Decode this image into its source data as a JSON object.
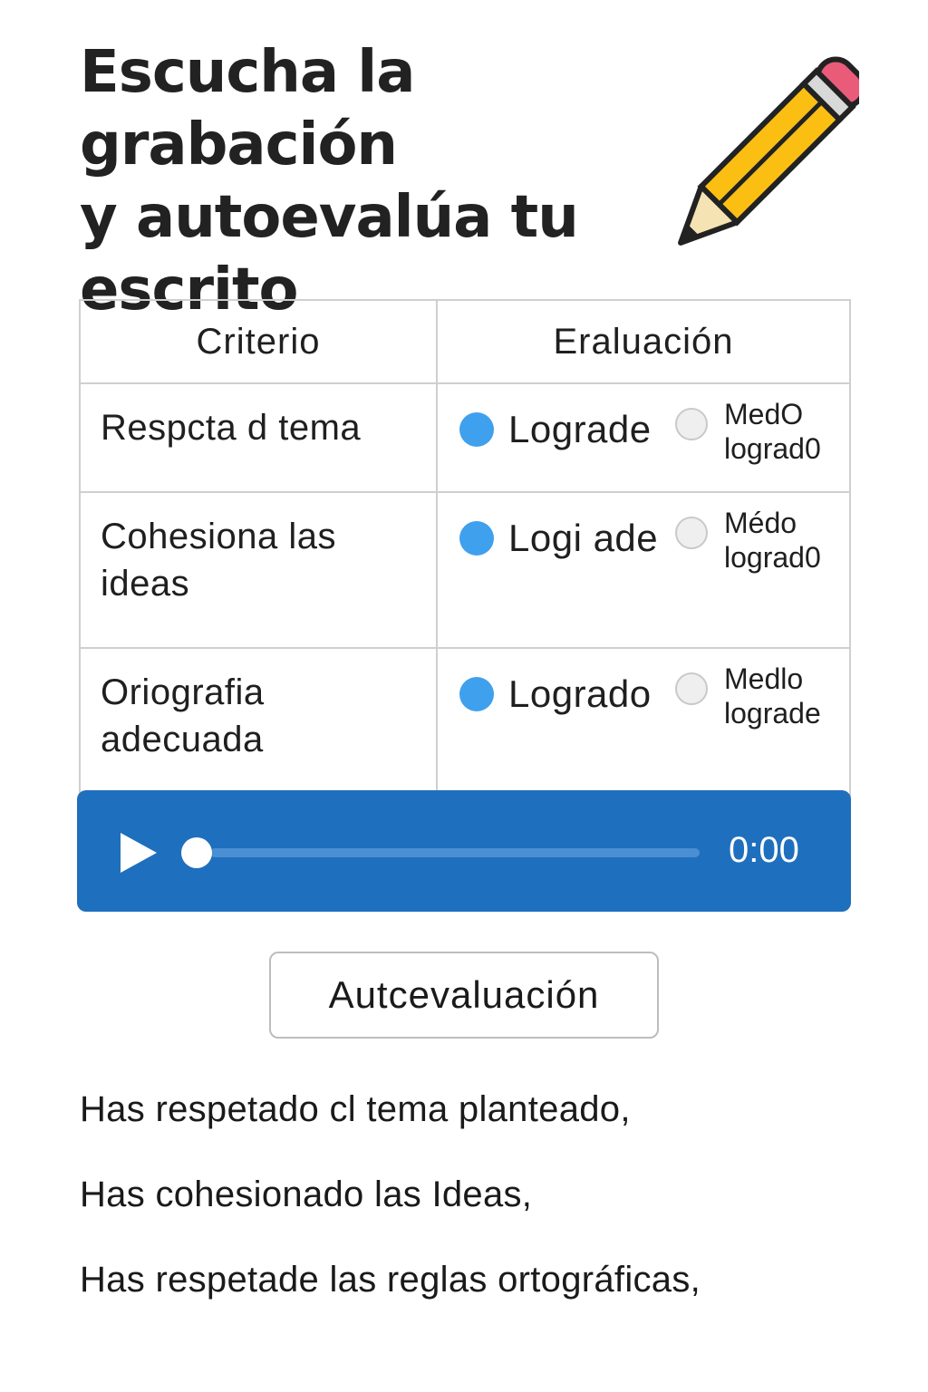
{
  "header": {
    "title_line1": "Escucha la grabación",
    "title_line2": "y autoevalúa tu",
    "title_line3": "escrito",
    "icon": "pencil-icon"
  },
  "table": {
    "headers": [
      "Criterio",
      "Eraluación"
    ],
    "rows": [
      {
        "criterio_lines": [
          "Respcta d tema"
        ],
        "logrado_label": "Lograde",
        "logrado_checked": true,
        "medio_lines": [
          "MedO",
          "lograd0"
        ],
        "medio_checked": false
      },
      {
        "criterio_lines": [
          "Cohesiona las",
          "ideas"
        ],
        "logrado_label": "Logi ade",
        "logrado_checked": true,
        "medio_lines": [
          "Médo",
          "lograd0"
        ],
        "medio_checked": false
      },
      {
        "criterio_lines": [
          "Oriografia",
          "adecuada"
        ],
        "logrado_label": "Logrado",
        "logrado_checked": true,
        "medio_lines": [
          "Medlo",
          "lograde"
        ],
        "medio_checked": false
      }
    ]
  },
  "player": {
    "time": "0:00",
    "progress": 0,
    "play_icon": "play-icon"
  },
  "button": {
    "label": "Autcevaluación"
  },
  "feedback": [
    "Has respetado cl tema planteado,",
    "Has cohesionado las Ideas,",
    "Has respetade las reglas ortográficas,"
  ],
  "colors": {
    "player_bg": "#1f6fbf",
    "radio_checked": "#3fa0ee",
    "pencil_body": "#fbbf14",
    "eraser": "#ea5b7a"
  }
}
